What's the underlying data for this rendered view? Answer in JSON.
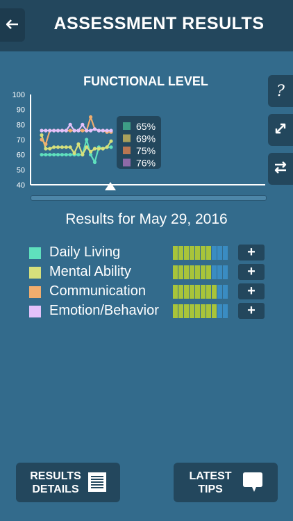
{
  "header": {
    "title": "ASSESSMENT RESULTS",
    "back_icon": "arrow-left-icon"
  },
  "side_buttons": {
    "help_label": "?",
    "expand_icon": "expand-arrows-icon",
    "swap_icon": "swap-arrows-icon"
  },
  "chart_title": "FUNCTIONAL LEVEL",
  "chart_data": {
    "type": "line",
    "title": "FUNCTIONAL LEVEL",
    "ylim": [
      40,
      100
    ],
    "yticks": [
      "40",
      "50",
      "60",
      "70",
      "80",
      "90",
      "100"
    ],
    "x": [
      1,
      2,
      3,
      4,
      5,
      6,
      7,
      8,
      9,
      10,
      11,
      12,
      13,
      14,
      15,
      16,
      17,
      18
    ],
    "series": [
      {
        "color": "#5fe0bd",
        "values": [
          60,
          60,
          60,
          60,
          60,
          60,
          60,
          60,
          60,
          60,
          60,
          70,
          60,
          55,
          65,
          64,
          65,
          65
        ]
      },
      {
        "color": "#d6e07c",
        "values": [
          73,
          64,
          64,
          65,
          65,
          65,
          65,
          65,
          61,
          67,
          60,
          65,
          62,
          64,
          64,
          64,
          65,
          69
        ]
      },
      {
        "color": "#f0ad6e",
        "values": [
          70,
          67,
          76,
          76,
          76,
          76,
          76,
          76,
          76,
          76,
          76,
          76,
          85,
          77,
          76,
          76,
          75,
          75
        ]
      },
      {
        "color": "#e4c1fa",
        "values": [
          76,
          76,
          76,
          76,
          76,
          76,
          76,
          80,
          76,
          76,
          80,
          76,
          76,
          77,
          76,
          76,
          76,
          76
        ]
      }
    ],
    "tooltip": {
      "entries": [
        {
          "label": "65%",
          "color": "#3e9d86"
        },
        {
          "label": "69%",
          "color": "#a9a05b"
        },
        {
          "label": "75%",
          "color": "#b97652"
        },
        {
          "label": "76%",
          "color": "#8e6aa8"
        }
      ]
    }
  },
  "results_date": "Results for May 29, 2016",
  "categories": [
    {
      "label": "Daily Living",
      "color": "#5fe0bd",
      "filled": 7,
      "total": 10
    },
    {
      "label": "Mental Ability",
      "color": "#d6e07c",
      "filled": 7,
      "total": 10
    },
    {
      "label": "Communication",
      "color": "#f0ad6e",
      "filled": 8,
      "total": 10
    },
    {
      "label": "Emotion/Behavior",
      "color": "#e4c1fa",
      "filled": 8,
      "total": 10
    }
  ],
  "plus_label": "+",
  "buttons": {
    "details_line1": "RESULTS",
    "details_line2": "DETAILS",
    "tips_line1": "LATEST",
    "tips_line2": "TIPS"
  }
}
